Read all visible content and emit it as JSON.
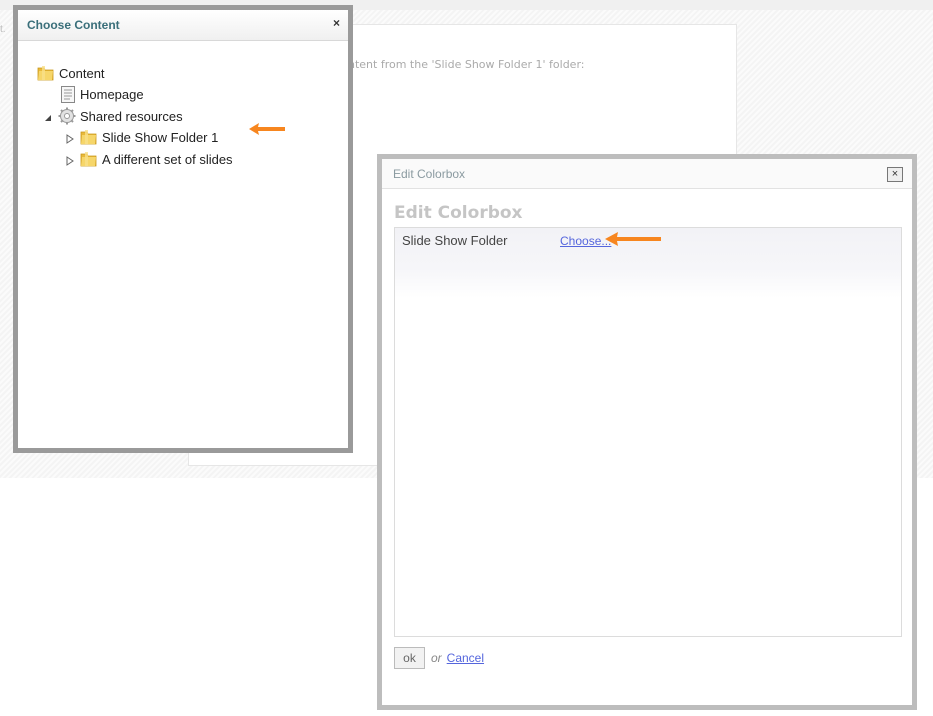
{
  "background": {
    "edge_char": "t.",
    "intro_text": "ntent from the 'Slide Show Folder 1' folder:"
  },
  "choose_dialog": {
    "title": "Choose Content",
    "close_label": "×",
    "tree": [
      {
        "label": "Content",
        "icon": "folder-icon",
        "expander": "none"
      },
      {
        "label": "Homepage",
        "icon": "page-icon",
        "expander": "none"
      },
      {
        "label": "Shared resources",
        "icon": "gear-icon",
        "expander": "expanded"
      },
      {
        "label": "Slide Show Folder 1",
        "icon": "folder-icon",
        "expander": "collapsed"
      },
      {
        "label": "A different set of slides",
        "icon": "folder-icon",
        "expander": "collapsed"
      }
    ]
  },
  "edit_dialog": {
    "header_title": "Edit Colorbox",
    "close_label": "×",
    "heading": "Edit Colorbox",
    "property_label": "Slide Show Folder",
    "property_action": "Choose...",
    "ok_label": "ok",
    "or_text": "or",
    "cancel_label": "Cancel"
  },
  "colors": {
    "arrow": "#f7861f",
    "title_teal": "#3a6f7a",
    "link_blue": "#5566dd",
    "folder_yellow": "#f2c94c"
  }
}
